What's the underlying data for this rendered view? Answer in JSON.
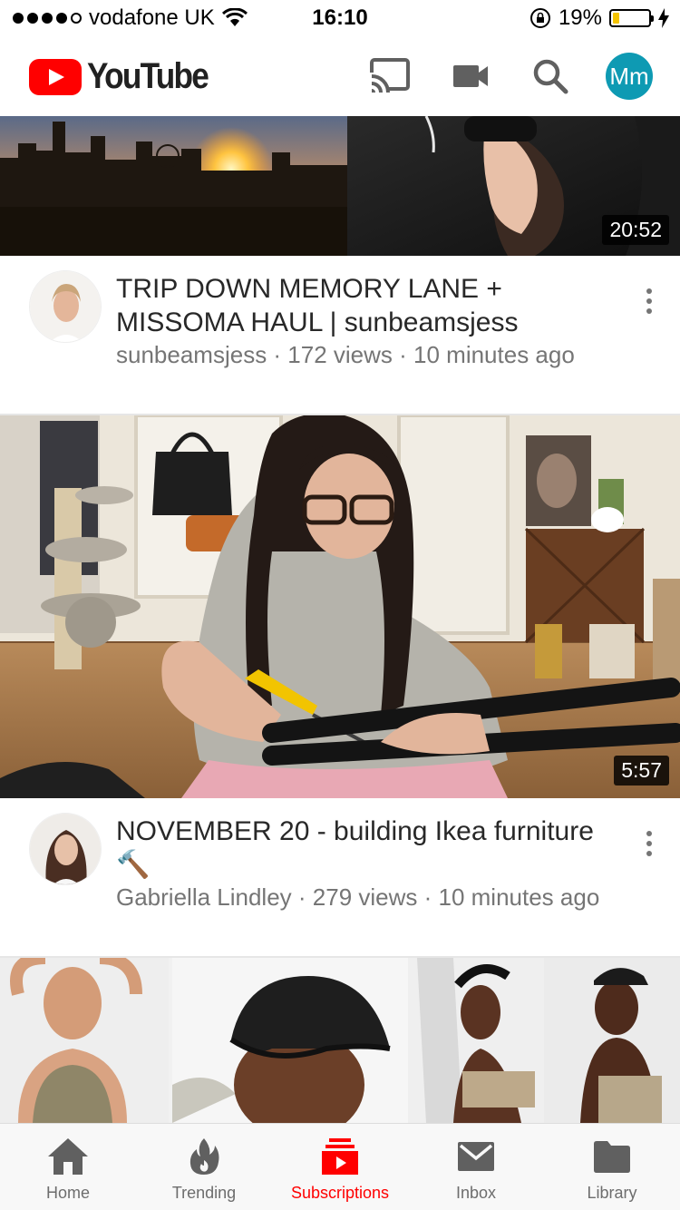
{
  "status_bar": {
    "carrier": "vodafone UK",
    "time": "16:10",
    "battery": "19%",
    "battery_level": 0.19
  },
  "header": {
    "logo_text": "YouTube",
    "avatar_initials": "Mm",
    "accent_color": "#ff0000",
    "avatar_color": "#0e9ab3"
  },
  "videos": [
    {
      "duration": "20:52",
      "title": "TRIP DOWN MEMORY LANE + MISSOMA HAUL | sunbeamsjess",
      "meta": "sunbeamsjess · 172 views · 10 minutes ago"
    },
    {
      "duration": "5:57",
      "title": "NOVEMBER 20 - building Ikea furniture 🔨",
      "meta": "Gabriella Lindley · 279 views · 10 minutes ago"
    }
  ],
  "nav": [
    {
      "label": "Home",
      "icon": "home-icon"
    },
    {
      "label": "Trending",
      "icon": "flame-icon"
    },
    {
      "label": "Subscriptions",
      "icon": "subscriptions-icon",
      "active": true
    },
    {
      "label": "Inbox",
      "icon": "mail-icon"
    },
    {
      "label": "Library",
      "icon": "folder-icon"
    }
  ]
}
